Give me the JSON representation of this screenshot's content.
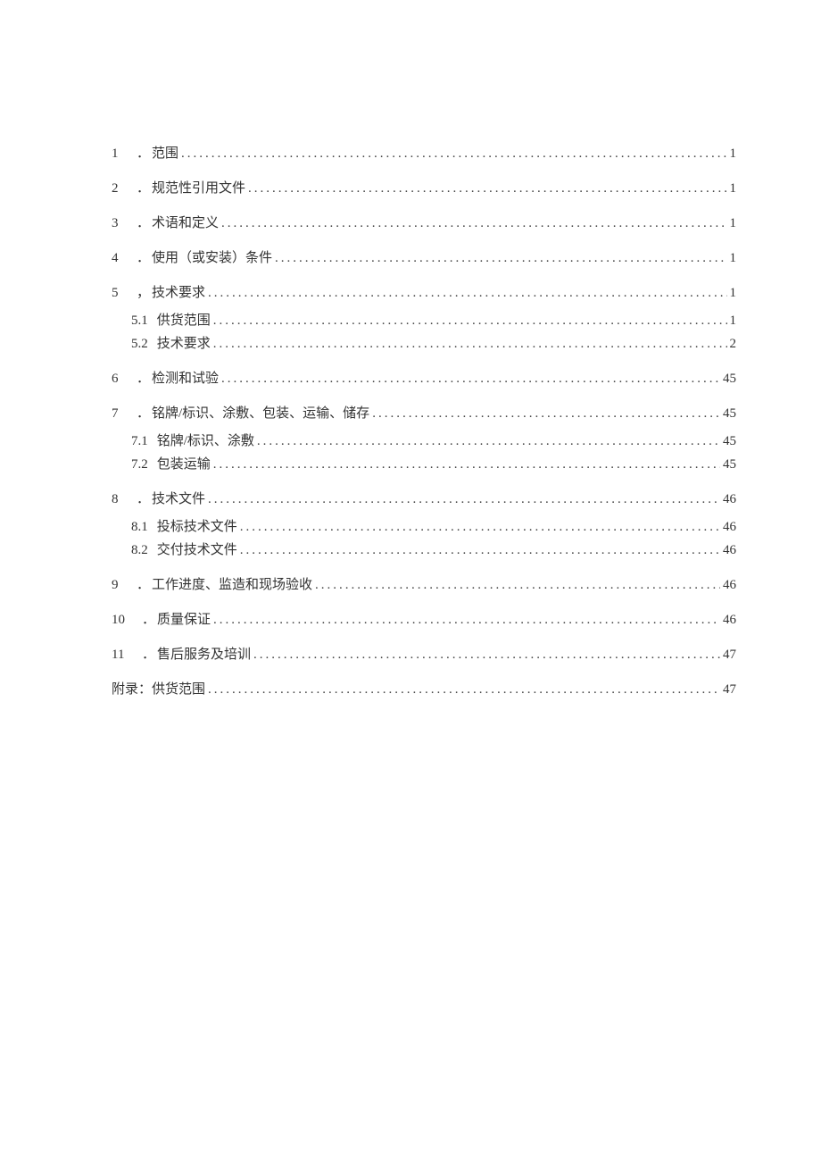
{
  "toc": {
    "dots": "........................................................................................................................",
    "entries": [
      {
        "num": "1",
        "sep": "．",
        "title": "范围",
        "page": "1"
      },
      {
        "num": "2",
        "sep": "．",
        "title": "规范性引用文件",
        "page": "1"
      },
      {
        "num": "3",
        "sep": "．",
        "title": "术语和定义",
        "page": "1"
      },
      {
        "num": "4",
        "sep": "．",
        "title": "使用（或安装）条件",
        "page": "1"
      },
      {
        "num": "5",
        "sep": "，",
        "title": "技术要求",
        "page": "1"
      },
      {
        "num": "6",
        "sep": "．",
        "title": "检测和试验",
        "page": "45"
      },
      {
        "num": "7",
        "sep": "．",
        "title": "铭牌/标识、涂敷、包装、运输、储存",
        "page": "45"
      },
      {
        "num": "8",
        "sep": "．",
        "title": "技术文件",
        "page": "46"
      },
      {
        "num": "9",
        "sep": "．",
        "title": "工作进度、监造和现场验收",
        "page": "46"
      },
      {
        "num": "10",
        "sep": "．",
        "title": "质量保证",
        "page": "46"
      },
      {
        "num": "11",
        "sep": "．",
        "title": "售后服务及培训",
        "page": "47"
      }
    ],
    "sub5": [
      {
        "num": "5.1",
        "title": "供货范围",
        "page": "1"
      },
      {
        "num": "5.2",
        "title": "技术要求",
        "page": "2"
      }
    ],
    "sub7": [
      {
        "num": "7.1",
        "title": "铭牌/标识、涂敷",
        "page": "45"
      },
      {
        "num": "7.2",
        "title": "包装运输",
        "page": "45"
      }
    ],
    "sub8": [
      {
        "num": "8.1",
        "title": "投标技术文件",
        "page": "46"
      },
      {
        "num": "8.2",
        "title": "交付技术文件",
        "page": "46"
      }
    ],
    "appendix": {
      "label": "附录：",
      "title": "供货范围",
      "page": "47"
    }
  }
}
